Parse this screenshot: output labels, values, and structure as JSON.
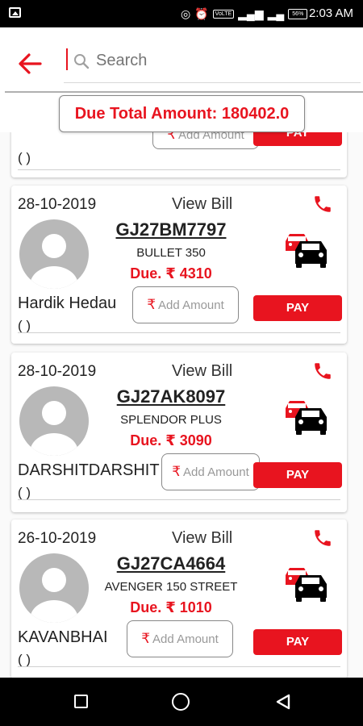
{
  "status_bar": {
    "time": "2:03 AM",
    "volte": "VoLTE",
    "battery": "56%"
  },
  "search": {
    "placeholder": "Search"
  },
  "due_total": "Due Total Amount: 180402.0",
  "partial_card": {
    "paren": "( )",
    "add_amount": "Add Amount",
    "pay": "PAY"
  },
  "cards": [
    {
      "date": "28-10-2019",
      "view_bill": "View Bill",
      "plate": "GJ27BM7797",
      "model": "BULLET 350",
      "due": "Due. ₹ 4310",
      "name": "Hardik Hedau",
      "paren": "( )",
      "add_amount": "Add Amount",
      "pay": "PAY"
    },
    {
      "date": "28-10-2019",
      "view_bill": "View Bill",
      "plate": "GJ27AK8097",
      "model": "SPLENDOR PLUS",
      "due": "Due. ₹ 3090",
      "name": "DARSHITDARSHIT",
      "paren": "( )",
      "add_amount": "Add Amount",
      "pay": "PAY"
    },
    {
      "date": "26-10-2019",
      "view_bill": "View Bill",
      "plate": "GJ27CA4664",
      "model": "AVENGER 150 STREET",
      "due": "Due. ₹ 1010",
      "name": "KAVANBHAI",
      "paren": "( )",
      "add_amount": "Add Amount",
      "pay": "PAY"
    }
  ],
  "rupee_symbol": "₹",
  "colors": {
    "accent": "#e8141f",
    "avatar": "#b8b8b8"
  },
  "icons": [
    "back-arrow-icon",
    "search-icon",
    "phone-icon",
    "cars-icon",
    "avatar-icon",
    "rupee-icon"
  ]
}
